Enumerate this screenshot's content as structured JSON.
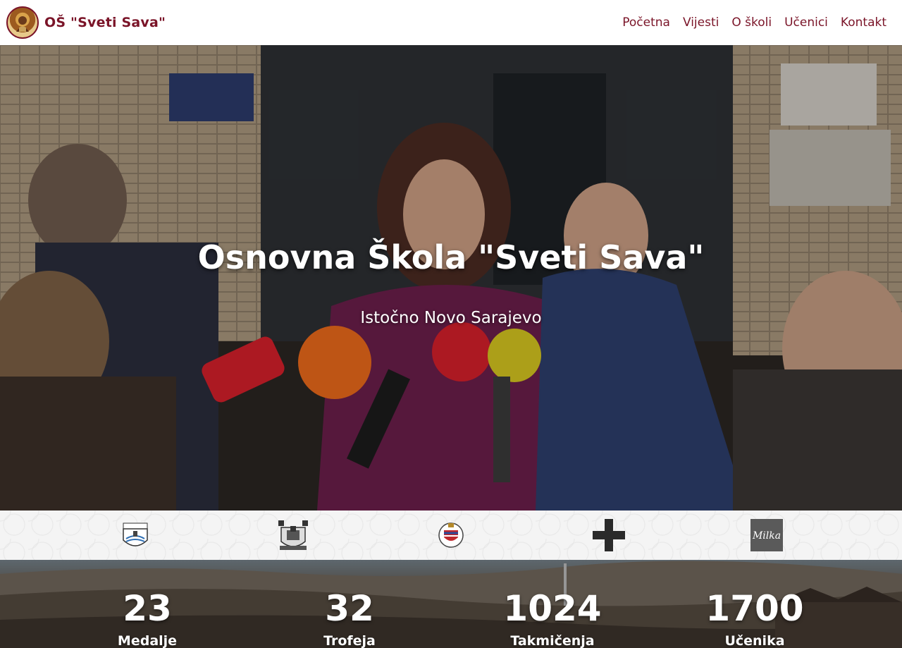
{
  "brand": {
    "name": "OŠ \"Sveti Sava\""
  },
  "nav": {
    "items": [
      {
        "label": "Početna"
      },
      {
        "label": "Vijesti"
      },
      {
        "label": "O školi"
      },
      {
        "label": "Učenici"
      },
      {
        "label": "Kontakt"
      }
    ]
  },
  "hero": {
    "title": "Osnovna Škola \"Sveti Sava\"",
    "subtitle": "Istočno Novo Sarajevo"
  },
  "sponsors": [
    {
      "icon": "municipality-crest-icon"
    },
    {
      "icon": "city-coat-of-arms-icon"
    },
    {
      "icon": "republic-seal-icon"
    },
    {
      "icon": "red-cross-plus-icon"
    },
    {
      "icon": "milka-logo-icon"
    }
  ],
  "stats": [
    {
      "value": "23",
      "label": "Medalje"
    },
    {
      "value": "32",
      "label": "Trofeja"
    },
    {
      "value": "1024",
      "label": "Takmičenja"
    },
    {
      "value": "1700",
      "label": "Učenika"
    }
  ],
  "colors": {
    "brand": "#7a1428",
    "white": "#ffffff"
  }
}
